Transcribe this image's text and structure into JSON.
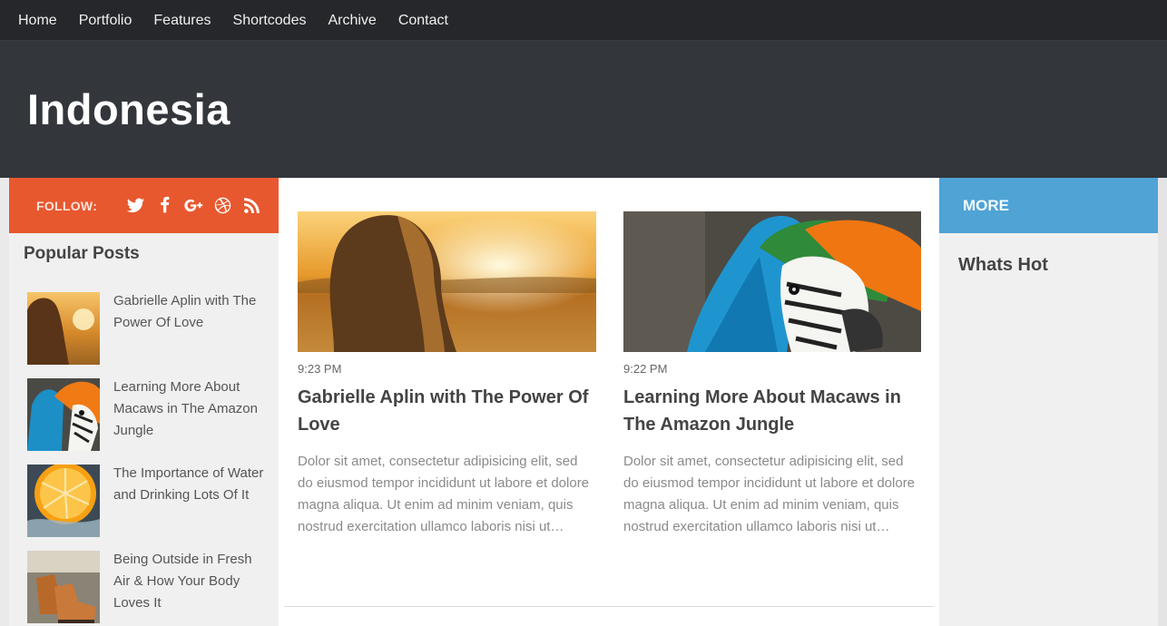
{
  "nav": {
    "items": [
      {
        "label": "Home"
      },
      {
        "label": "Portfolio"
      },
      {
        "label": "Features"
      },
      {
        "label": "Shortcodes"
      },
      {
        "label": "Archive"
      },
      {
        "label": "Contact"
      }
    ]
  },
  "header": {
    "site_title": "Indonesia"
  },
  "follow": {
    "label": "FOLLOW:",
    "icons": [
      "twitter-icon",
      "facebook-icon",
      "google-plus-icon",
      "dribbble-icon",
      "rss-icon"
    ]
  },
  "popular": {
    "title": "Popular Posts",
    "items": [
      {
        "title": "Gabrielle Aplin with The Power Of Love",
        "thumb": "girl-sunset"
      },
      {
        "title": "Learning More About Macaws in The Amazon Jungle",
        "thumb": "macaw"
      },
      {
        "title": "The Importance of Water and Drinking Lots Of It",
        "thumb": "orange-slice"
      },
      {
        "title": "Being Outside in Fresh Air & How Your Body Loves It",
        "thumb": "boots"
      }
    ]
  },
  "posts": [
    {
      "time": "9:23 PM",
      "title": "Gabrielle Aplin with The Power Of Love",
      "excerpt": "Dolor sit amet, consectetur adipisicing elit, sed do eiusmod tempor incididunt ut labore et dolore magna aliqua. Ut enim ad minim veniam, quis nostrud exercitation ullamco laboris nisi ut…",
      "thumb": "girl-sunset"
    },
    {
      "time": "9:22 PM",
      "title": "Learning More About Macaws in The Amazon Jungle",
      "excerpt": "Dolor sit amet, consectetur adipisicing elit, sed do eiusmod tempor incididunt ut labore et dolore magna aliqua. Ut enim ad minim veniam, quis nostrud exercitation ullamco laboris nisi ut…",
      "thumb": "macaw"
    }
  ],
  "right": {
    "more_label": "MORE",
    "whats_hot": "Whats Hot"
  },
  "colors": {
    "nav_bg": "#26272b",
    "header_bg": "#33363b",
    "follow_bg": "#e8582f",
    "more_bg": "#4fa3d5"
  }
}
